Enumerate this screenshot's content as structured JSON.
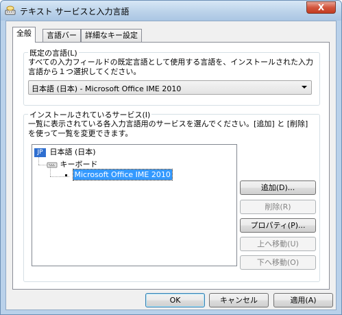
{
  "window": {
    "title": "テキスト サービスと入力言語",
    "close_glyph": "X"
  },
  "tabs": [
    {
      "label": "全般",
      "active": true
    },
    {
      "label": "言語バー",
      "active": false
    },
    {
      "label": "詳細なキー設定",
      "active": false
    }
  ],
  "default_language": {
    "group_title": "既定の言語(L)",
    "description": "すべての入力フィールドの既定言語として使用する言語を、インストールされた入力言語から１つ選択してください。",
    "selected": "日本語 (日本) - Microsoft Office IME 2010"
  },
  "installed_services": {
    "group_title": "インストールされているサービス(I)",
    "description": "一覧に表示されている各入力言語用のサービスを選んでください。[追加] と [削除] を使って一覧を変更できます。",
    "tree": {
      "language_badge": "JP",
      "language": "日本語 (日本)",
      "category": "キーボード",
      "service": "Microsoft Office IME 2010"
    },
    "buttons": {
      "add": "追加(D)...",
      "remove": "削除(R)",
      "properties": "プロパティ(P)...",
      "move_up": "上へ移動(U)",
      "move_down": "下へ移動(O)"
    }
  },
  "footer": {
    "ok": "OK",
    "cancel": "キャンセル",
    "apply": "適用(A)"
  },
  "colors": {
    "selection": "#3399ff",
    "badge": "#2f6fd0",
    "title_gradient_top": "#d7e7f6",
    "close": "#c23b20"
  }
}
